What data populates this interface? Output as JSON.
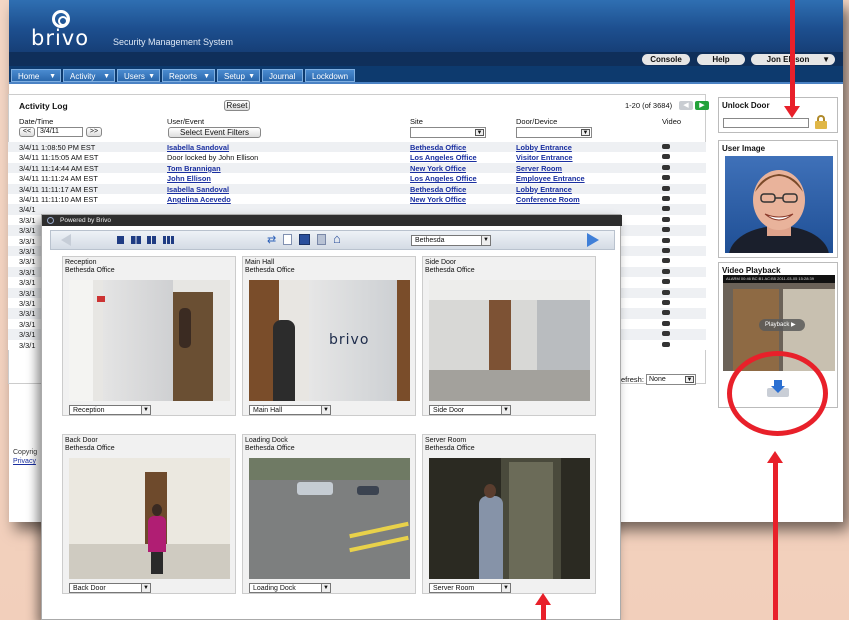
{
  "header": {
    "logo_text": "brivo",
    "subtitle": "Security Management System",
    "util_buttons": [
      "Console",
      "Help",
      "Jon Ellison"
    ]
  },
  "nav": {
    "items": [
      "Home",
      "Activity",
      "Users",
      "Reports",
      "Setup",
      "Journal",
      "Lockdown"
    ]
  },
  "activity_log": {
    "title": "Activity Log",
    "reset_label": "Reset",
    "pager": "1-20 (of 3684)",
    "columns": {
      "datetime": "Date/Time",
      "user_event": "User/Event",
      "site": "Site",
      "door": "Door/Device",
      "video": "Video"
    },
    "date_value": "3/4/11",
    "prev_label": "<<",
    "next_label": ">>",
    "filter_label": "Select Event Filters",
    "rows": [
      {
        "time": "3/4/11 1:08:50 PM EST",
        "user": "Isabella Sandoval",
        "site": "Bethesda Office",
        "door": "Lobby Entrance"
      },
      {
        "time": "3/4/11 11:15:05 AM EST",
        "user": "Door locked by John Ellison",
        "site": "Los Angeles Office",
        "door": "Visitor Entrance"
      },
      {
        "time": "3/4/11 11:14:44 AM EST",
        "user": "Tom Brannigan",
        "site": "New York Office",
        "door": "Server Room"
      },
      {
        "time": "3/4/11 11:11:24 AM EST",
        "user": "John Ellison",
        "site": "Los Angeles Office",
        "door": "Employee Entrance"
      },
      {
        "time": "3/4/11 11:11:17 AM EST",
        "user": "Isabella Sandoval",
        "site": "Bethesda Office",
        "door": "Lobby Entrance"
      },
      {
        "time": "3/4/11 11:11:10 AM EST",
        "user": "Angelina Acevedo",
        "site": "New York Office",
        "door": "Conference Room"
      },
      {
        "time": "3/4/1",
        "user": "",
        "site": "",
        "door": ""
      },
      {
        "time": "3/3/1",
        "user": "",
        "site": "",
        "door": ""
      },
      {
        "time": "3/3/1",
        "user": "",
        "site": "",
        "door": ""
      },
      {
        "time": "3/3/1",
        "user": "",
        "site": "",
        "door": ""
      },
      {
        "time": "3/3/1",
        "user": "",
        "site": "",
        "door": ""
      },
      {
        "time": "3/3/1",
        "user": "",
        "site": "",
        "door": ""
      },
      {
        "time": "3/3/1",
        "user": "",
        "site": "",
        "door": ""
      },
      {
        "time": "3/3/1",
        "user": "",
        "site": "",
        "door": ""
      },
      {
        "time": "3/3/1",
        "user": "",
        "site": "",
        "door": ""
      },
      {
        "time": "3/3/1",
        "user": "",
        "site": "",
        "door": ""
      },
      {
        "time": "3/3/1",
        "user": "",
        "site": "",
        "door": ""
      },
      {
        "time": "3/3/1",
        "user": "",
        "site": "",
        "door": ""
      },
      {
        "time": "3/3/1",
        "user": "",
        "site": "",
        "door": ""
      },
      {
        "time": "3/3/1",
        "user": "",
        "site": "",
        "door": ""
      }
    ],
    "refresh_label": "efresh:",
    "refresh_value": "None"
  },
  "footer": {
    "copyright": "Copyrig",
    "privacy": "Privacy"
  },
  "right_panel": {
    "unlock_title": "Unlock Door",
    "user_image_title": "User Image",
    "video_playback_title": "Video Playback",
    "video_overlay": "ALARM 00:46 BC:B1 AC:B5 2011-03-05 15:28:39",
    "play_label": "Playback"
  },
  "viewer": {
    "powered_by": "Powered by Brivo",
    "site_select": "Bethesda",
    "cameras": [
      {
        "name": "Reception",
        "site": "Bethesda Office",
        "select": "Reception"
      },
      {
        "name": "Main Hall",
        "site": "Bethesda Office",
        "select": "Main Hall"
      },
      {
        "name": "Side Door",
        "site": "Bethesda Office",
        "select": "Side Door"
      },
      {
        "name": "Back Door",
        "site": "Bethesda Office",
        "select": "Back Door"
      },
      {
        "name": "Loading Dock",
        "site": "Bethesda Office",
        "select": "Loading Dock"
      },
      {
        "name": "Server Room",
        "site": "Bethesda Office",
        "select": "Server Room"
      }
    ],
    "brand_on_glass": "brivo"
  },
  "colors": {
    "brand_blue": "#1d4f8f",
    "nav_blue": "#2b68ad",
    "link_blue": "#1a2fa0",
    "callout_red": "#e8202a",
    "background": "#f2cfbb"
  }
}
